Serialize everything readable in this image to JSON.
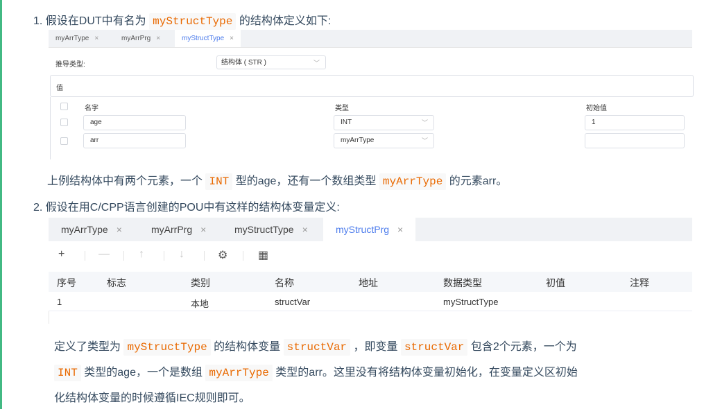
{
  "item1": {
    "number": "1.",
    "text_before": "假设在DUT中有名为",
    "code": "myStructType",
    "text_after": "的结构体定义如下:"
  },
  "screenshot1": {
    "tabs": [
      {
        "label": "myArrType"
      },
      {
        "label": "myArrPrg"
      },
      {
        "label": "myStructType"
      }
    ],
    "close_glyph": "×",
    "derived_type_label": "推导类型:",
    "derived_type_value": "结构体 ( STR )",
    "values_label": "值",
    "columns": {
      "name": "名字",
      "type": "类型",
      "init": "初始值"
    },
    "rows": [
      {
        "name": "age",
        "type": "INT",
        "init": "1"
      },
      {
        "name": "arr",
        "type": "myArrType",
        "init": ""
      }
    ]
  },
  "para1": {
    "t1": "上例结构体中有两个元素，一个",
    "c1": "INT",
    "t2": "型的age，还有一个数组类型",
    "c2": "myArrType",
    "t3": "的元素arr。"
  },
  "item2": {
    "number": "2.",
    "text": "假设在用C/CPP语言创建的POU中有这样的结构体变量定义:"
  },
  "screenshot2": {
    "tabs": [
      {
        "label": "myArrType"
      },
      {
        "label": "myArrPrg"
      },
      {
        "label": "myStructType"
      },
      {
        "label": "myStructPrg"
      }
    ],
    "close_glyph": "×",
    "toolbar": {
      "add": "+",
      "remove": "—",
      "up": "↑",
      "down": "↓",
      "settings": "⚙",
      "grid": "▦"
    },
    "columns": [
      "序号",
      "标志",
      "类别",
      "名称",
      "地址",
      "数据类型",
      "初值",
      "注释"
    ],
    "rows": [
      {
        "index": "1",
        "flag": "",
        "category": "本地",
        "name": "structVar",
        "address": "",
        "datatype": "myStructType",
        "init": "",
        "comment": ""
      }
    ]
  },
  "para2": {
    "l1_t1": "定义了类型为",
    "l1_c1": "myStructType",
    "l1_t2": "的结构体变量",
    "l1_c2": "structVar",
    "l1_t3": "，即变量",
    "l1_c3": "structVar",
    "l1_t4": "包含2个元素，一个为",
    "l2_c1": "INT",
    "l2_t1": "类型的age，一个是数组",
    "l2_c2": "myArrType",
    "l2_t2": "类型的arr。这里没有将结构体变量初始化，在变量定义区初始",
    "l3_t1": "化结构体变量的时候遵循IEC规则即可。"
  },
  "colors": {
    "accent_bar": "#42b983",
    "code_text": "#e96900",
    "code_bg": "#f8f8f8",
    "active_tab": "#4b7bec"
  }
}
